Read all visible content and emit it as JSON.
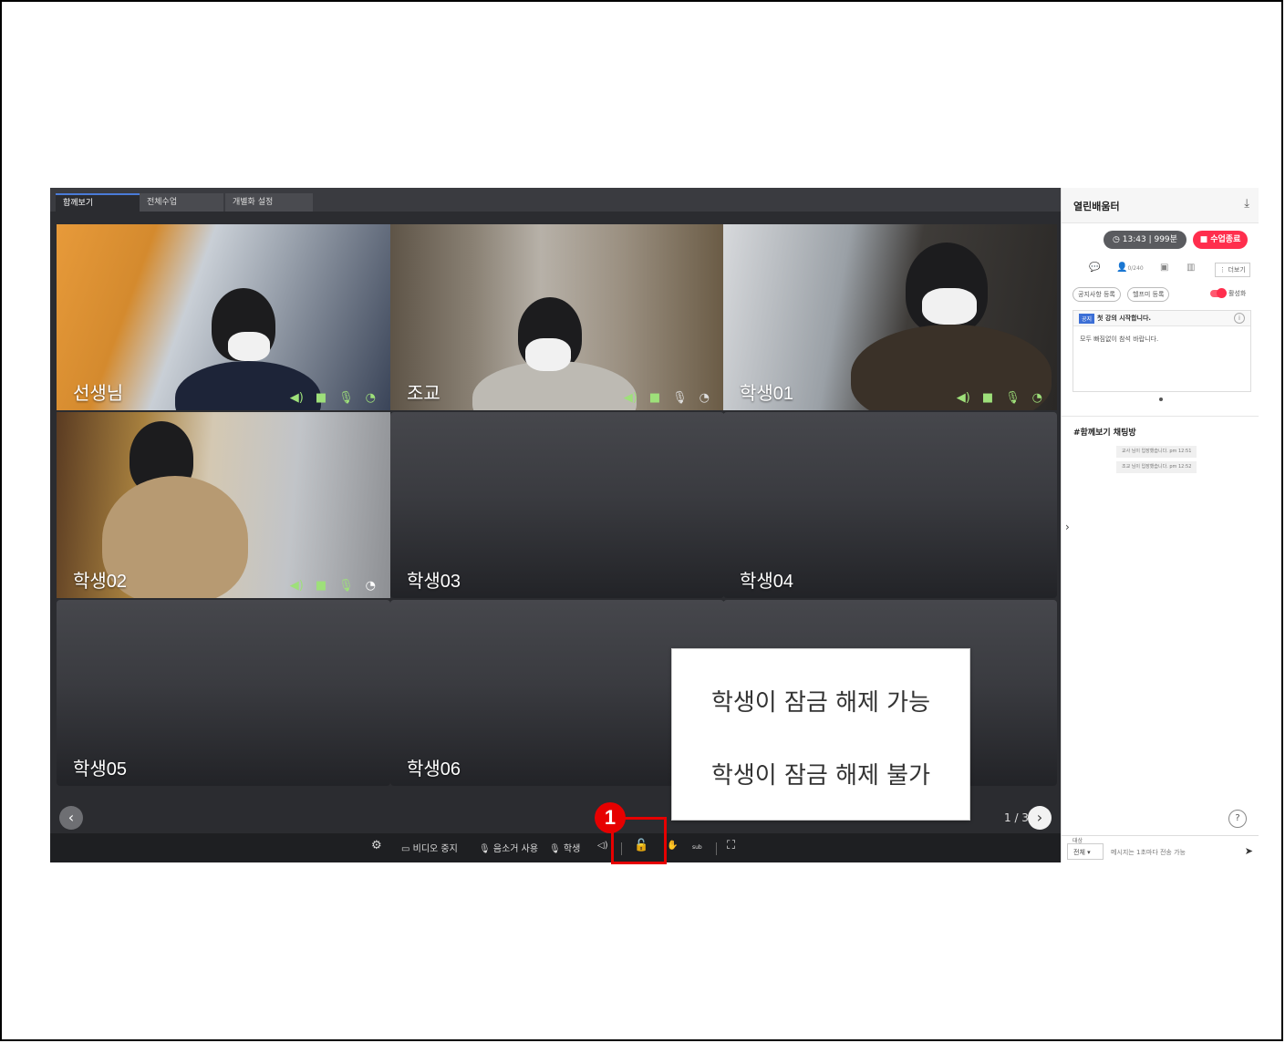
{
  "tabs": [
    "함께보기",
    "전체수업",
    "개별화 설정"
  ],
  "tiles": [
    {
      "name": "선생님",
      "has_video": true
    },
    {
      "name": "조교",
      "has_video": true
    },
    {
      "name": "학생01",
      "has_video": true
    },
    {
      "name": "학생02",
      "has_video": true
    },
    {
      "name": "학생03",
      "has_video": false
    },
    {
      "name": "학생04",
      "has_video": false
    },
    {
      "name": "학생05",
      "has_video": false
    },
    {
      "name": "학생06",
      "has_video": false
    }
  ],
  "pager": {
    "text": "1 / 3"
  },
  "toolbar": {
    "video_stop": "비디오 중지",
    "speaker_use": "음소거 사용",
    "student": "학생",
    "sub_label": "sub"
  },
  "side": {
    "title": "열린배움터",
    "time": "13:43",
    "minutes": "999분",
    "end_button": "수업종료",
    "people_count": "0/240",
    "more": "더보기",
    "chip_notice": "공지사항 등록",
    "chip_help": "헬프미 등록",
    "toggle_label": "활성화",
    "notice_badge": "공지",
    "notice_title": "첫 강의 시작합니다.",
    "notice_body": "모두 빠짐없이 참석 바랍니다.",
    "chat_title": "#함께보기 채팅방",
    "chat_messages": [
      "교사 님이 입장했습니다. pm 12:51",
      "조교 님이 입장했습니다. pm 12:52"
    ],
    "target_label": "대상",
    "target_value": "전체",
    "message_placeholder": "메시지는 1초마다 전송 가능"
  },
  "popup": {
    "option_unlock_allowed": "학생이 잠금 해제 가능",
    "option_unlock_denied": "학생이 잠금 해제 불가"
  },
  "marker": {
    "number": "1"
  },
  "colors": {
    "accent_red": "#e60000",
    "end_button": "#ff2e4d",
    "status_green": "#9ee07a"
  }
}
